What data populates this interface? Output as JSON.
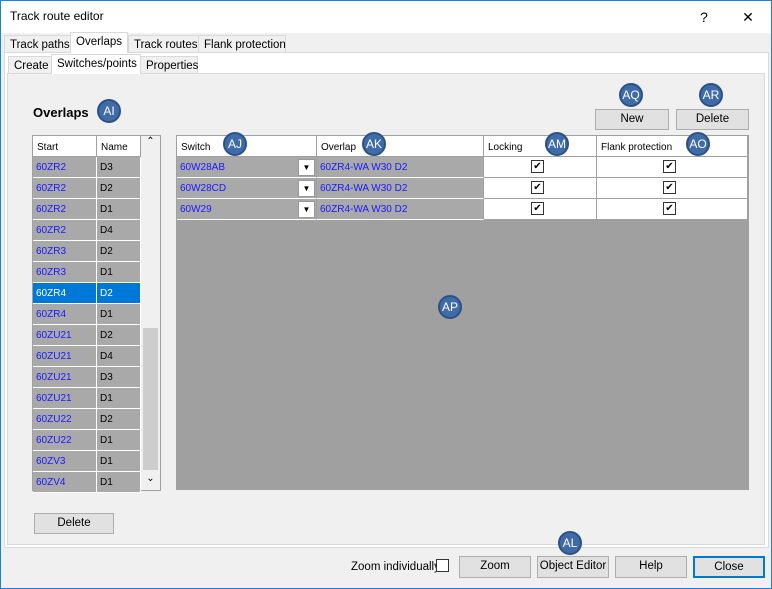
{
  "window": {
    "title": "Track route editor",
    "help": "?",
    "close": "✕"
  },
  "tabs": [
    {
      "label": "Track paths"
    },
    {
      "label": "Overlaps",
      "selected": true
    },
    {
      "label": "Track routes"
    },
    {
      "label": "Flank protection"
    }
  ],
  "subtabs": [
    {
      "label": "Create"
    },
    {
      "label": "Switches/points",
      "selected": true
    },
    {
      "label": "Properties"
    }
  ],
  "section_title": "Overlaps",
  "markers": {
    "ai": "AI",
    "aj": "AJ",
    "ak": "AK",
    "am": "AM",
    "ao": "AO",
    "ap": "AP",
    "aq": "AQ",
    "ar": "AR",
    "al": "AL"
  },
  "overlap_list": {
    "columns": [
      "Start",
      "Name"
    ],
    "rows": [
      {
        "start": "60ZR2",
        "name": "D3"
      },
      {
        "start": "60ZR2",
        "name": "D2"
      },
      {
        "start": "60ZR2",
        "name": "D1"
      },
      {
        "start": "60ZR2",
        "name": "D4"
      },
      {
        "start": "60ZR3",
        "name": "D2"
      },
      {
        "start": "60ZR3",
        "name": "D1"
      },
      {
        "start": "60ZR4",
        "name": "D2",
        "selected": true
      },
      {
        "start": "60ZR4",
        "name": "D1"
      },
      {
        "start": "60ZU21",
        "name": "D2"
      },
      {
        "start": "60ZU21",
        "name": "D4"
      },
      {
        "start": "60ZU21",
        "name": "D3"
      },
      {
        "start": "60ZU21",
        "name": "D1"
      },
      {
        "start": "60ZU22",
        "name": "D2"
      },
      {
        "start": "60ZU22",
        "name": "D1"
      },
      {
        "start": "60ZV3",
        "name": "D1"
      },
      {
        "start": "60ZV4",
        "name": "D1"
      }
    ],
    "delete_label": "Delete"
  },
  "switch_table": {
    "columns": [
      "Switch",
      "Overlap",
      "Locking",
      "Flank protection"
    ],
    "rows": [
      {
        "switch": "60W28AB",
        "overlap": "60ZR4-WA W30 D2",
        "locking": true,
        "flank": true
      },
      {
        "switch": "60W28CD",
        "overlap": "60ZR4-WA W30 D2",
        "locking": true,
        "flank": true
      },
      {
        "switch": "60W29",
        "overlap": "60ZR4-WA W30 D2",
        "locking": true,
        "flank": true
      }
    ],
    "new_label": "New",
    "delete_label": "Delete"
  },
  "footer": {
    "zoom_individually": "Zoom individually",
    "zoom_individually_checked": false,
    "zoom": "Zoom",
    "object_editor": "Object Editor",
    "help": "Help",
    "close": "Close"
  },
  "colors": {
    "accent": "#0078d7",
    "link": "#1a1aff",
    "marker": "#3f6ca8"
  }
}
